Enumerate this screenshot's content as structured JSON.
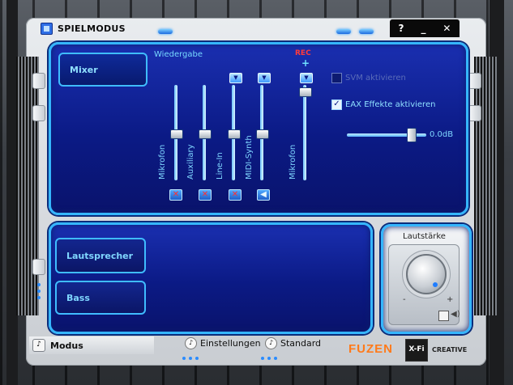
{
  "window": {
    "title": "SPIELMODUS",
    "controls": {
      "help": "?",
      "minimize": "_",
      "close": "✕"
    }
  },
  "mixer": {
    "mode_label": "Mixer",
    "section_label": "Wiedergabe",
    "rec_label": "REC",
    "rec_plus": "+",
    "faders": [
      {
        "label": "Mikrofon",
        "muted": true
      },
      {
        "label": "Auxiliary",
        "muted": true
      },
      {
        "label": "Line-In",
        "muted": true
      },
      {
        "label": "MIDI-Synth",
        "muted": false
      }
    ],
    "rec_fader": {
      "label": "Mikrofon"
    },
    "svm_label": "SVM aktivieren",
    "svm_checked": false,
    "eax_label": "EAX Effekte aktivieren",
    "eax_checked": true,
    "eax_level": "0.0dB"
  },
  "speaker": {
    "lautsprecher_label": "Lautsprecher",
    "bass_label": "Bass"
  },
  "volume": {
    "title": "Lautstärke",
    "minus": "-",
    "plus": "+"
  },
  "footer": {
    "modus_label": "Modus",
    "einstellungen_label": "Einstellungen",
    "standard_label": "Standard",
    "fuzen_logo": "FUZEN",
    "xfi_logo": "X-Fi",
    "creative_logo": "CREATIVE"
  }
}
